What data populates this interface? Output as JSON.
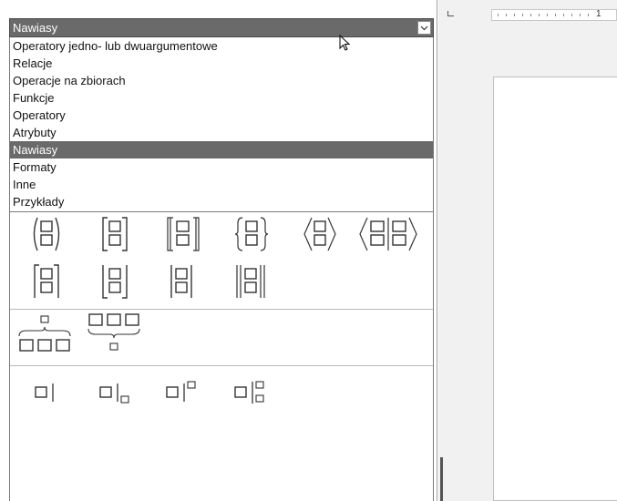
{
  "combo": {
    "selected": "Nawiasy"
  },
  "categories": [
    "Operatory jedno- lub dwuargumentowe",
    "Relacje",
    "Operacje na zbiorach",
    "Funkcje",
    "Operatory",
    "Atrybuty",
    "Nawiasy",
    "Formaty",
    "Inne",
    "Przykłady"
  ],
  "selected_index": 6,
  "symbols": {
    "brackets_row1": [
      "round-brackets-icon",
      "square-brackets-icon",
      "double-square-brackets-icon",
      "curly-brackets-icon",
      "angle-brackets-icon",
      "operator-brackets-icon"
    ],
    "brackets_row2": [
      "ceiling-icon",
      "floor-icon",
      "single-lines-icon",
      "double-lines-icon"
    ],
    "braces": [
      "overbrace-icon",
      "underbrace-icon"
    ],
    "evaluate": [
      "evaluate-icon",
      "evaluate-subscript-icon",
      "evaluate-superscript-icon",
      "evaluate-sub-superscript-icon"
    ]
  },
  "ruler": {
    "mark": "1"
  }
}
